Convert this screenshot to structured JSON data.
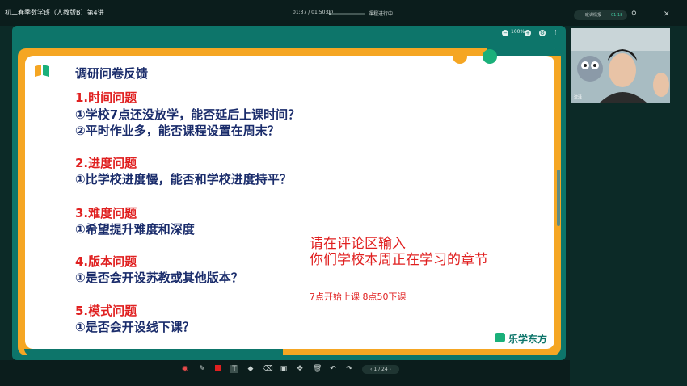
{
  "titlebar": {
    "app_title": "初二春季数学班（人教版B）第4讲",
    "time_elapsed": "01:37",
    "time_total": "01:50:00",
    "time_display": "01:37 / 01:50:00",
    "status": "课程进行中",
    "progress_fraction": 0.015,
    "class_tag_label": "班课情报",
    "class_tag_time": "01:18"
  },
  "board": {
    "zoom_label": "100%"
  },
  "slide": {
    "title": "调研问卷反馈",
    "sections": [
      {
        "head": "1.时间问题",
        "items": [
          "①学校7点还没放学，能否延后上课时间？",
          "②平时作业多，能否课程设置在周末？"
        ]
      },
      {
        "head": "2.进度问题",
        "items": [
          "①比学校进度慢，能否和学校进度持平？"
        ]
      },
      {
        "head": "3.难度问题",
        "items": [
          "①希望提升难度和深度"
        ]
      },
      {
        "head": "4.版本问题",
        "items": [
          "①是否会开设苏教或其他版本？"
        ]
      },
      {
        "head": "5.模式问题",
        "items": [
          "①是否会开设线下课？"
        ]
      }
    ],
    "comment_line1": "请在评论区输入",
    "comment_line2": "你们学校本周正在学习的章节",
    "schedule_note": "7点开始上课    8点50下课",
    "brand": "乐学东方"
  },
  "toolbar": {
    "page_label": "1 / 24"
  },
  "video": {
    "teacher_name": "沈泽"
  },
  "colors": {
    "board_teal": "#0d756a",
    "slide_orange": "#f5a623",
    "heading_red": "#e02020",
    "text_navy": "#1a2c6b"
  }
}
